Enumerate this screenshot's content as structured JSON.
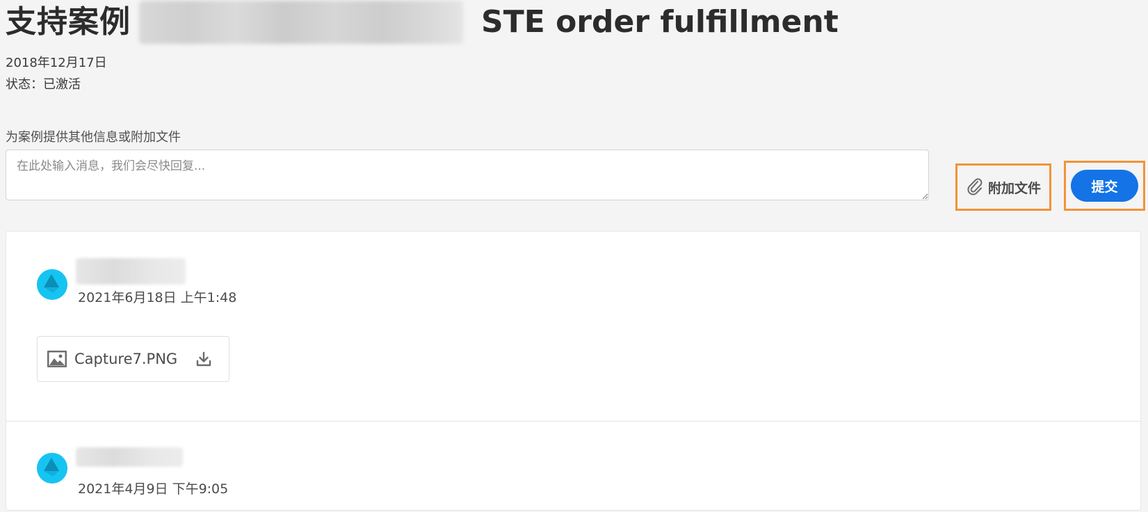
{
  "case": {
    "title_prefix": "支持案例",
    "subject": "STE order fulfillment",
    "date": "2018年12月17日",
    "status_label": "状态：",
    "status_value": "已激活"
  },
  "composer": {
    "label": "为案例提供其他信息或附加文件",
    "placeholder": "在此处输入消息，我们会尽快回复...",
    "attach_label": "附加文件",
    "submit_label": "提交"
  },
  "comments": [
    {
      "time": "2021年6月18日 上午1:48",
      "attachments": [
        {
          "file_name": "Capture7.PNG"
        }
      ]
    },
    {
      "time": "2021年4月9日 下午9:05",
      "attachments": []
    }
  ],
  "colors": {
    "accent_blue": "#1473e6",
    "highlight_orange": "#f29337",
    "avatar_cyan": "#16c4f2"
  },
  "icons": {
    "attach": "paperclip-icon",
    "attachment_type": "image-icon",
    "download": "download-icon",
    "avatar": "avatar"
  }
}
